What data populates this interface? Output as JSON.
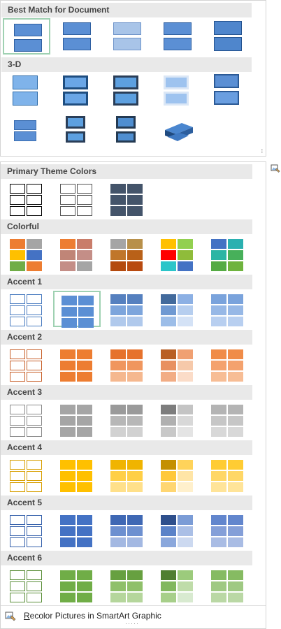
{
  "sections": {
    "best_match": "Best Match for Document",
    "three_d": "3-D",
    "primary": "Primary Theme Colors",
    "colorful": "Colorful",
    "accent1": "Accent 1",
    "accent2": "Accent 2",
    "accent3": "Accent 3",
    "accent4": "Accent 4",
    "accent5": "Accent 5",
    "accent6": "Accent 6"
  },
  "footer": {
    "accel": "R",
    "rest": "ecolor Pictures in SmartArt Graphic"
  },
  "colors": {
    "blue": "#5b8fd4",
    "orange": "#e97b3c",
    "gray": "#a0a0a0",
    "gold": "#ffc000",
    "navy": "#4472c4",
    "green": "#70ad47",
    "selection": "#9fd1b2"
  },
  "icons": {
    "recolor": "recolor-pictures-icon",
    "pin": "picture-pin-icon"
  }
}
